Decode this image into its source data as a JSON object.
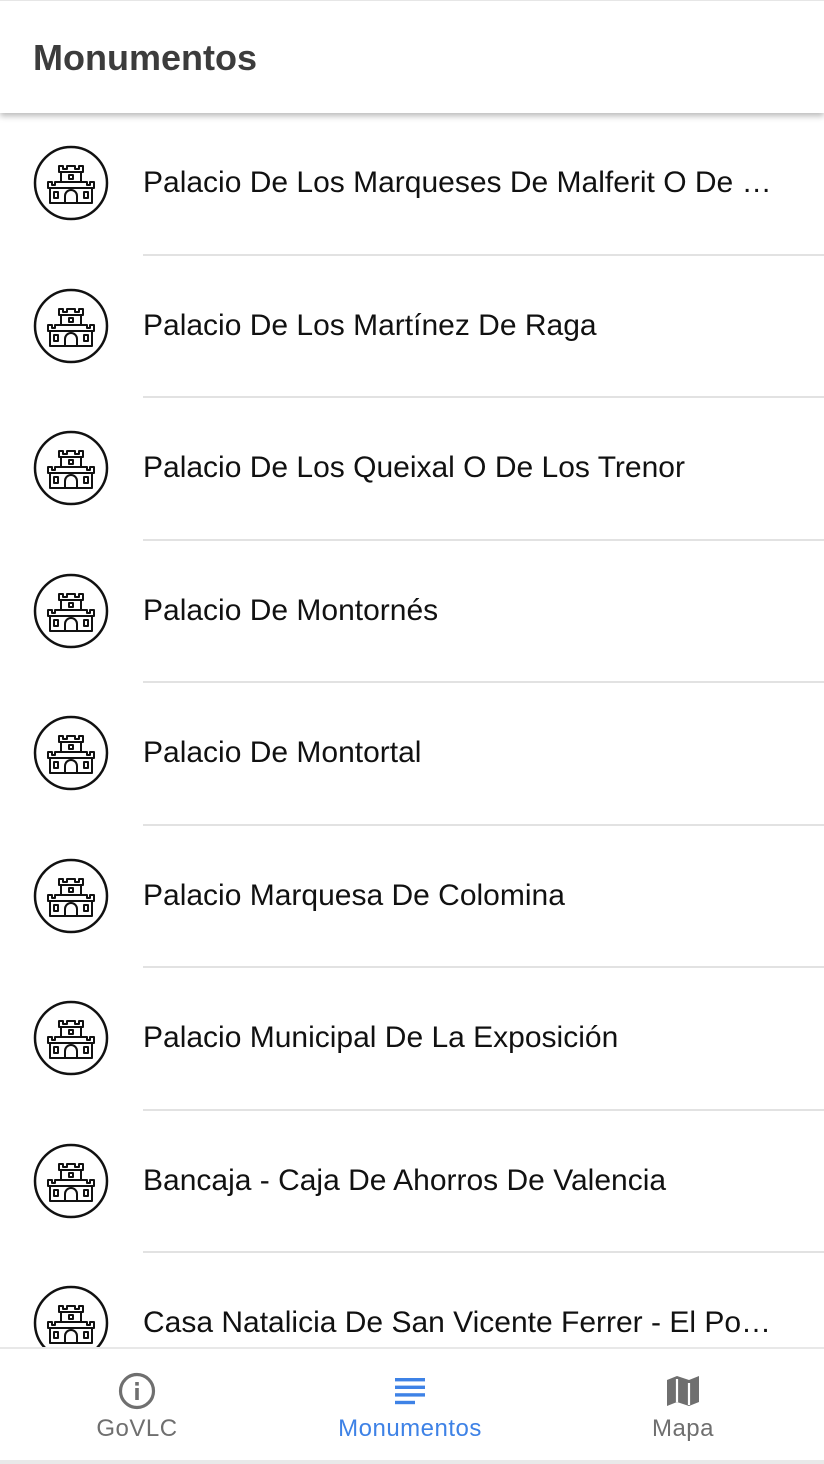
{
  "app_bar": {
    "title": "Monumentos"
  },
  "list": {
    "icon": "castle-icon",
    "items": [
      {
        "label": "Palacio De Los Marqueses De Malferit O De …"
      },
      {
        "label": "Palacio De Los Martínez De Raga"
      },
      {
        "label": "Palacio De Los Queixal O De Los Trenor"
      },
      {
        "label": "Palacio De Montornés"
      },
      {
        "label": "Palacio De Montortal"
      },
      {
        "label": "Palacio Marquesa De Colomina"
      },
      {
        "label": "Palacio Municipal De La Exposición"
      },
      {
        "label": "Bancaja - Caja De Ahorros De Valencia"
      },
      {
        "label": "Casa Natalicia De San Vicente Ferrer - El Po…"
      }
    ]
  },
  "bottom_nav": {
    "items": [
      {
        "label": "GoVLC",
        "icon": "info-icon",
        "active": false
      },
      {
        "label": "Monumentos",
        "icon": "list-icon",
        "active": true
      },
      {
        "label": "Mapa",
        "icon": "map-icon",
        "active": false
      }
    ]
  },
  "colors": {
    "accent": "#3e82e6",
    "inactive": "#6f6f6f",
    "title": "#3c3c3c",
    "divider": "#e2e2e2"
  }
}
